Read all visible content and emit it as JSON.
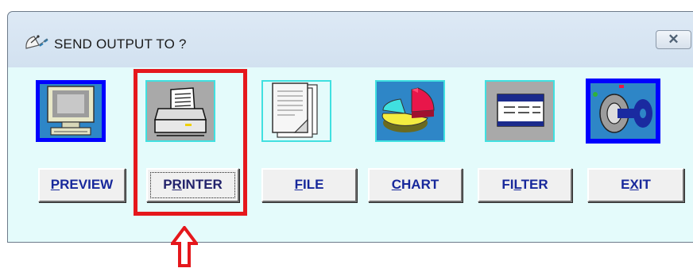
{
  "window": {
    "title": "SEND OUTPUT TO ?",
    "close_icon": "close-x-icon"
  },
  "options": [
    {
      "id": "preview",
      "label_pre": "",
      "label_key": "P",
      "label_post": "REVIEW",
      "icon": "monitor-icon",
      "frame_color": "#0000ff"
    },
    {
      "id": "printer",
      "label_pre": "P",
      "label_key": "R",
      "label_post": "INTER",
      "icon": "printer-icon",
      "frame_color": "#40e0e0"
    },
    {
      "id": "file",
      "label_pre": "",
      "label_key": "F",
      "label_post": "ILE",
      "icon": "document-icon",
      "frame_color": "#40e0e0"
    },
    {
      "id": "chart",
      "label_pre": "",
      "label_key": "C",
      "label_post": "HART",
      "icon": "pie-chart-icon",
      "frame_color": "#40e0e0"
    },
    {
      "id": "filter",
      "label_pre": "FI",
      "label_key": "L",
      "label_post": "TER",
      "icon": "table-filter-icon",
      "frame_color": "#40e0e0"
    },
    {
      "id": "exit",
      "label_pre": "E",
      "label_key": "X",
      "label_post": "IT",
      "icon": "key-icon",
      "frame_color": "#0000ff"
    }
  ],
  "annotation": {
    "highlight_target": "printer",
    "highlight_color": "#e5171c",
    "arrow_icon": "up-arrow-icon"
  }
}
